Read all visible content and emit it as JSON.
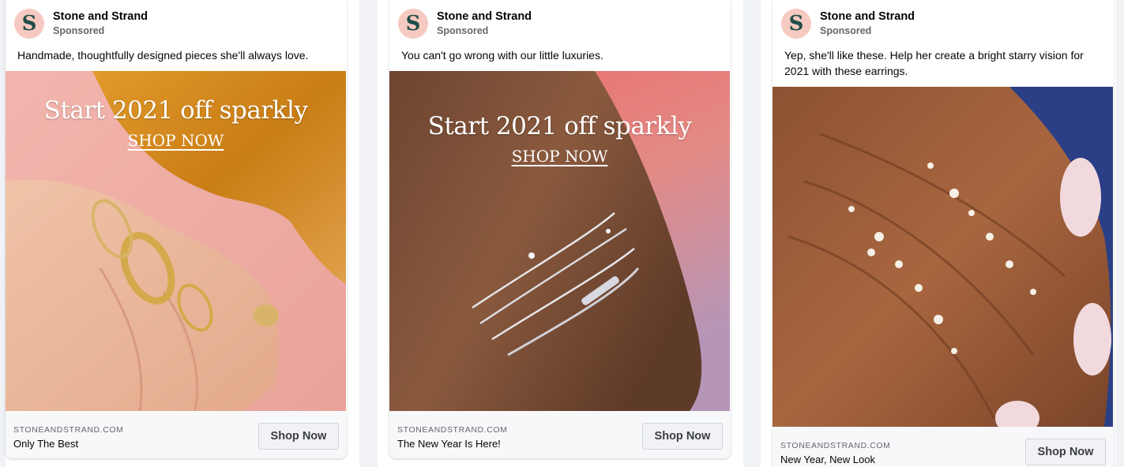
{
  "ads": [
    {
      "brand": "Stone and Strand",
      "sponsored": "Sponsored",
      "logo_letter": "S",
      "caption": "Handmade, thoughtfully designed pieces she'll always love.",
      "overlay_title": "Start 2021 off sparkly",
      "overlay_link": "SHOP NOW",
      "domain": "STONEANDSTRAND.COM",
      "headline": "Only The Best",
      "cta": "Shop Now"
    },
    {
      "brand": "Stone and Strand",
      "sponsored": "Sponsored",
      "logo_letter": "S",
      "caption": "You can't go wrong with our little luxuries.",
      "overlay_title": "Start 2021 off sparkly",
      "overlay_link": "SHOP NOW",
      "domain": "STONEANDSTRAND.COM",
      "headline": "The New Year Is Here!",
      "cta": "Shop Now"
    },
    {
      "brand": "Stone and Strand",
      "sponsored": "Sponsored",
      "logo_letter": "S",
      "caption": "Yep, she'll like these. Help her create a bright starry vision for 2021 with these earrings.",
      "domain": "STONEANDSTRAND.COM",
      "headline": "New Year, New Look",
      "cta": "Shop Now"
    }
  ],
  "colors": {
    "logo_bg": "#f6c9c1",
    "logo_letter": "#1f4f47",
    "page_gap": "#f0f2f5",
    "footer_bg": "#f7f8fa"
  }
}
